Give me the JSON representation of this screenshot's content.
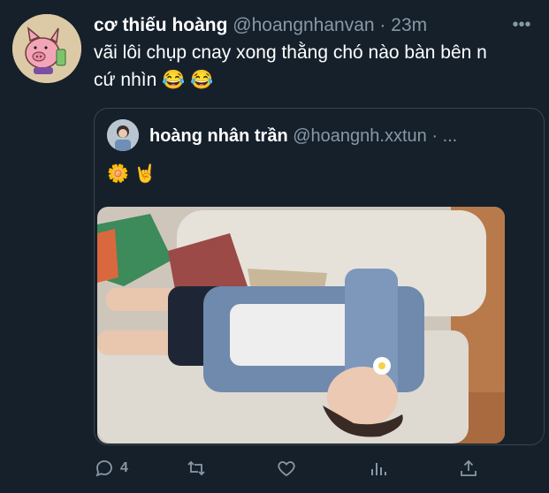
{
  "tweet": {
    "display_name": "cơ thiếu hoàng",
    "handle": "@hoangnhanvan",
    "separator": "·",
    "time": "23m",
    "more": "•••",
    "text_line1": "vãi lôi chụp cnay xong thằng chó nào bàn bên n",
    "text_line2": "cứ nhìn 😂 😂"
  },
  "quoted": {
    "display_name": "hoàng nhân trần",
    "handle": "@hoangnh.xxtun",
    "separator": "·",
    "ellipsis": "...",
    "text": "🌼 🤘"
  },
  "actions": {
    "reply_count": "4",
    "icons": [
      "reply-icon",
      "retweet-icon",
      "like-icon",
      "analytics-icon",
      "share-icon"
    ]
  },
  "colors": {
    "background": "#15202b",
    "muted": "#8899a6",
    "border": "#38444d"
  }
}
